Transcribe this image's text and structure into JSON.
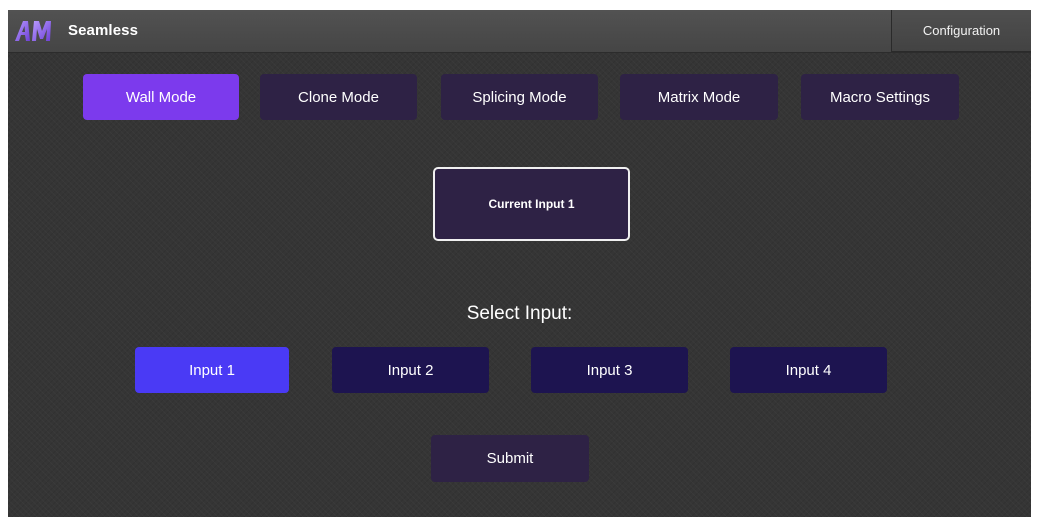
{
  "header": {
    "brand": "Seamless",
    "logo_icon": "am-logo-icon",
    "config_label": "Configuration"
  },
  "modes": {
    "items": [
      {
        "label": "Wall Mode",
        "active": true
      },
      {
        "label": "Clone Mode",
        "active": false
      },
      {
        "label": "Splicing Mode",
        "active": false
      },
      {
        "label": "Matrix Mode",
        "active": false
      },
      {
        "label": "Macro Settings",
        "active": false
      }
    ]
  },
  "current": {
    "label": "Current Input 1"
  },
  "select": {
    "label": "Select Input:",
    "inputs": [
      {
        "label": "Input 1",
        "active": true
      },
      {
        "label": "Input 2",
        "active": false
      },
      {
        "label": "Input 3",
        "active": false
      },
      {
        "label": "Input 4",
        "active": false
      }
    ]
  },
  "submit": {
    "label": "Submit"
  },
  "colors": {
    "active_mode": "#7c3aed",
    "inactive_mode": "#2e2245",
    "active_input": "#4a3af5",
    "inactive_input": "#1d1450",
    "background": "#353535"
  }
}
